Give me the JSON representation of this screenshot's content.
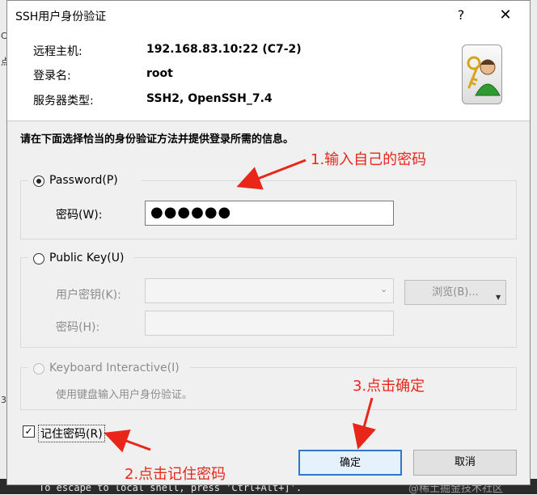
{
  "background": {
    "terminal_text": "To escape to local shell, press 'Ctrl+Alt+]'.",
    "watermark": "@稀土掘金技术社区",
    "left_fragments": [
      "C",
      "点",
      "3."
    ]
  },
  "dialog": {
    "title": "SSH用户身份验证",
    "help_label": "?",
    "close_label": "✕",
    "info": {
      "host_label": "远程主机:",
      "host_value": "192.168.83.10:22 (C7-2)",
      "login_label": "登录名:",
      "login_value": "root",
      "server_type_label": "服务器类型:",
      "server_type_value": "SSH2, OpenSSH_7.4"
    },
    "instruction": "请在下面选择恰当的身份验证方法并提供登录所需的信息。",
    "password_option": {
      "label": "Password(P)",
      "field_label": "密码(W):",
      "field_value": "●●●●●●"
    },
    "public_key_option": {
      "label": "Public Key(U)",
      "key_label": "用户密钥(K):",
      "browse_label": "浏览(B)...",
      "passphrase_label": "密码(H):"
    },
    "keyboard_option": {
      "label": "Keyboard Interactive(I)",
      "description": "使用键盘输入用户身份验证。"
    },
    "remember_label": "记住密码(R)",
    "ok_label": "确定",
    "cancel_label": "取消"
  },
  "annotations": {
    "step1": "1.输入自己的密码",
    "step2": "2.点击记住密码",
    "step3": "3.点击确定"
  },
  "colors": {
    "annotation": "#e8261a",
    "default_button_border": "#2f77c8"
  }
}
